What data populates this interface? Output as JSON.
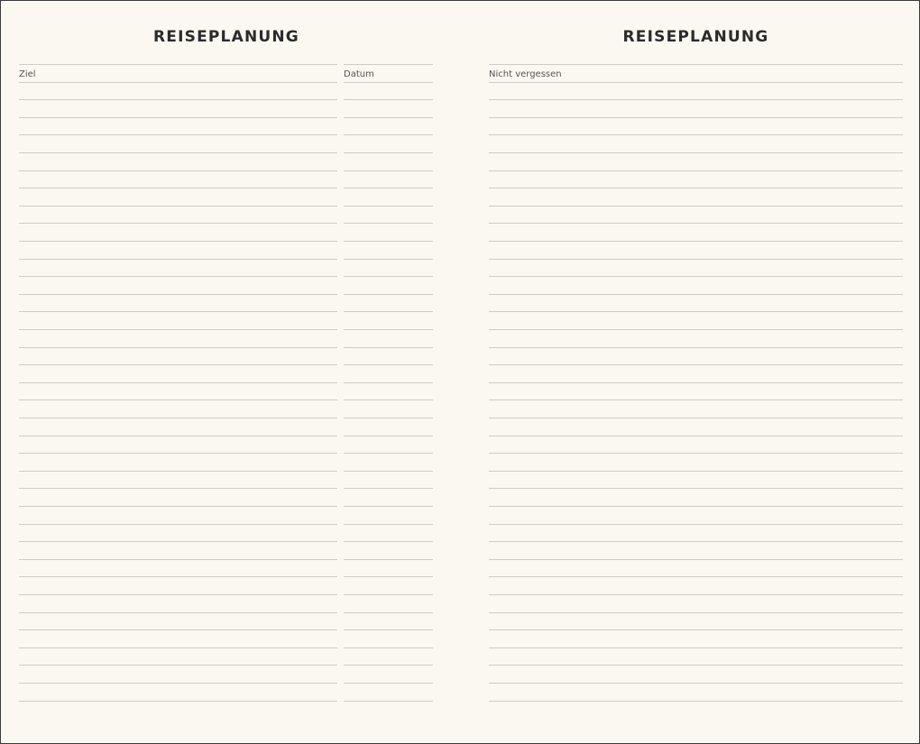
{
  "left_page": {
    "title": "REISEPLANUNG",
    "columns": {
      "destination_label": "Ziel",
      "date_label": "Datum"
    }
  },
  "right_page": {
    "title": "REISEPLANUNG",
    "columns": {
      "notes_label": "Nicht vergessen"
    }
  },
  "colors": {
    "paper": "#fbf7f1",
    "rule": "#cfccc6",
    "title": "#2b2b2b",
    "label": "#555555"
  }
}
